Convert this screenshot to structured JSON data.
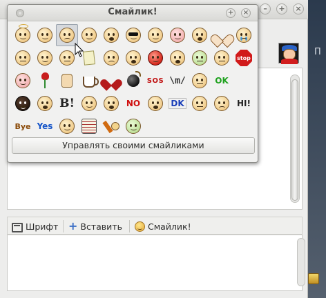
{
  "popup": {
    "title": "Смайлик!",
    "manage_button": "Управлять своими смайликами"
  },
  "toolbar": {
    "font_label": "Шрифт",
    "insert_label": "Вставить",
    "smiley_label": "Смайлик!"
  },
  "side_label": "П",
  "emoticons": {
    "sos": "SOS",
    "m": "\\m/",
    "ok": "OK",
    "b": "B!",
    "no": "NO",
    "dk": "DK",
    "hi": "HI!",
    "bye": "Bye",
    "yes": "Yes",
    "stop": "stop"
  },
  "colors": {
    "accent": "#3b6fc6",
    "window_bg": "#ededec"
  }
}
